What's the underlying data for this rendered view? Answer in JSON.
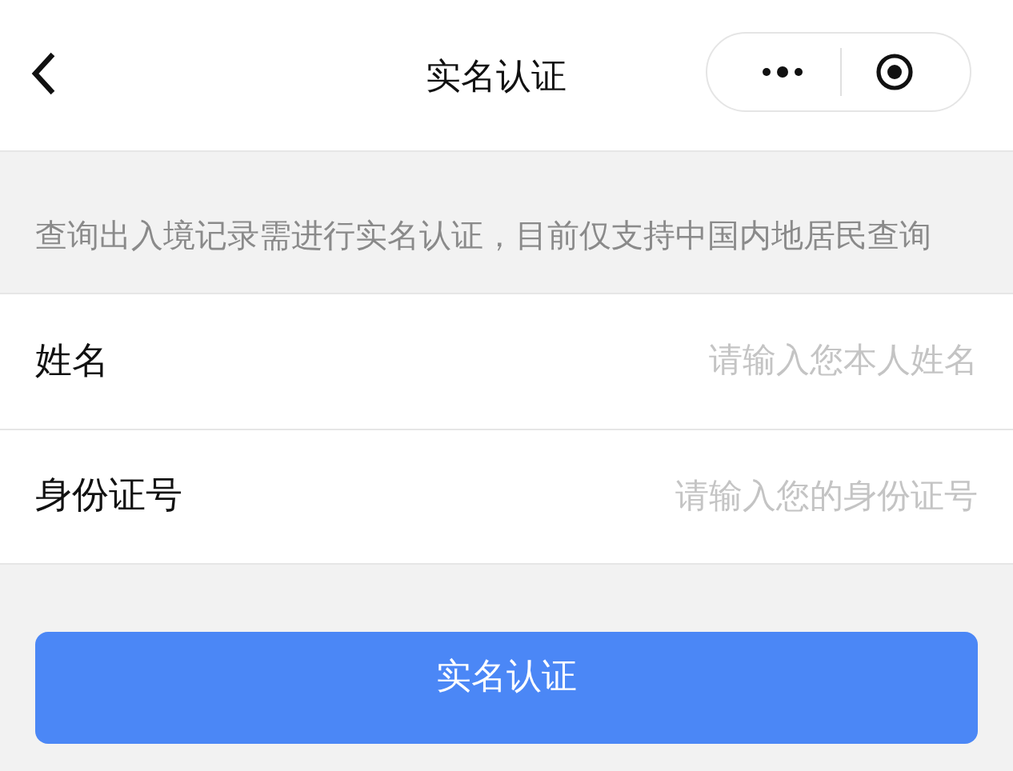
{
  "header": {
    "title": "实名认证"
  },
  "notice": "查询出入境记录需进行实名认证，目前仅支持中国内地居民查询",
  "fields": [
    {
      "label": "姓名",
      "placeholder": "请输入您本人姓名"
    },
    {
      "label": "身份证号",
      "placeholder": "请输入您的身份证号"
    }
  ],
  "submit": "实名认证"
}
